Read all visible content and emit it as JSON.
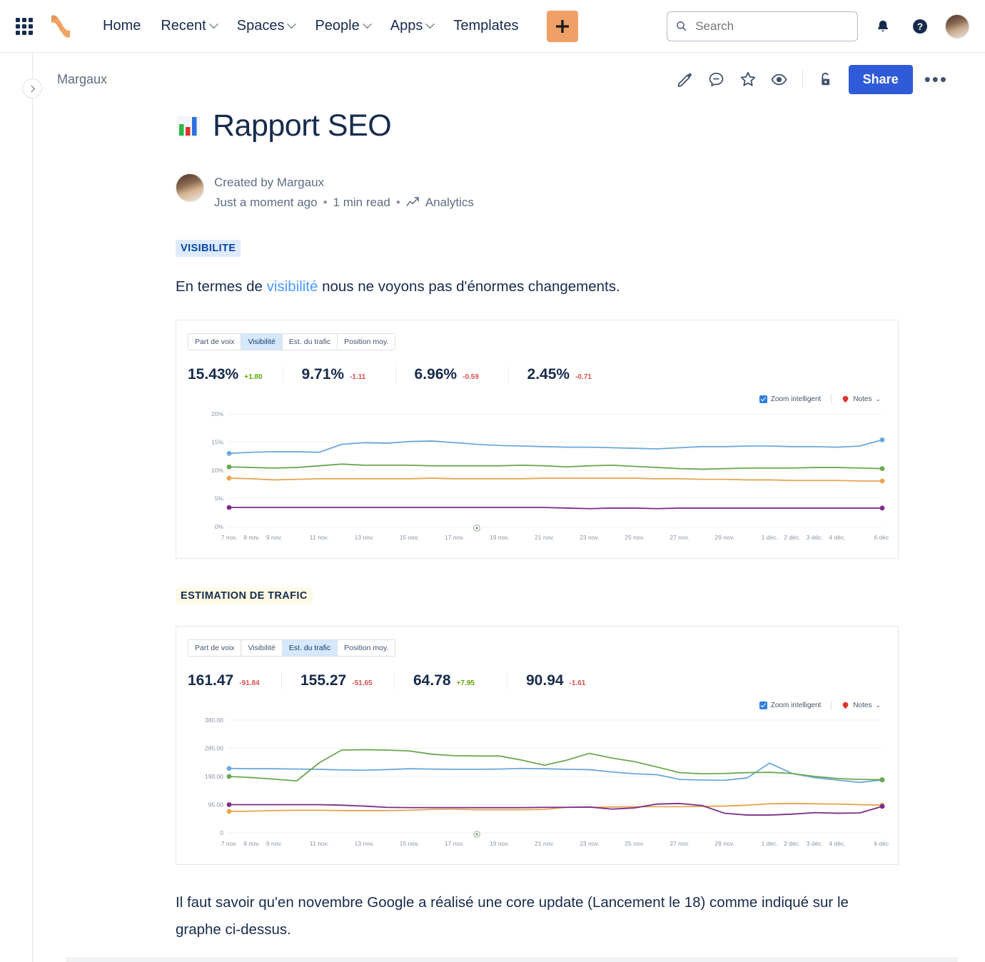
{
  "nav": {
    "app_switcher": "app-switcher-icon",
    "logo": "confluence-logo",
    "items": [
      {
        "label": "Home",
        "has_menu": false
      },
      {
        "label": "Recent",
        "has_menu": true
      },
      {
        "label": "Spaces",
        "has_menu": true
      },
      {
        "label": "People",
        "has_menu": true
      },
      {
        "label": "Apps",
        "has_menu": true
      },
      {
        "label": "Templates",
        "has_menu": false
      }
    ],
    "create_label": "+",
    "search_placeholder": "Search",
    "search_value": "",
    "notifications_icon": "notifications-bell-icon",
    "help_icon": "help-icon",
    "avatar": "user-avatar"
  },
  "page": {
    "breadcrumb": "Margaux",
    "actions": [
      "edit-icon",
      "comment-icon",
      "star-icon",
      "watch-icon",
      "restrictions-icon"
    ],
    "share_label": "Share",
    "more_label": "•••"
  },
  "document": {
    "title": "Rapport SEO",
    "title_emoji": "bar-chart-emoji",
    "created_by": "Created by Margaux",
    "timestamp": "Just a moment ago",
    "read_time": "1 min read",
    "analytics_label": "Analytics",
    "separator": "•",
    "section1": {
      "badge": "VISIBILITE",
      "paragraph_before": "En termes de ",
      "paragraph_link": "visibilité",
      "paragraph_after": " nous ne voyons pas d'énormes changements."
    },
    "section2": {
      "badge": "ESTIMATION DE TRAFIC"
    },
    "closing_paragraph": "Il faut savoir qu'en novembre Google a réalisé une core update (Lancement le 18) comme indiqué sur le graphe ci-dessus."
  },
  "charts_ui": {
    "tabs": [
      "Part de voix",
      "Visibilité",
      "Est. du trafic",
      "Position moy."
    ],
    "zoom_label": "Zoom intelligent",
    "notes_label": "Notes",
    "notes_chevron": "chevron-down-icon"
  },
  "chart_data": [
    {
      "type": "line",
      "title": "Visibilité",
      "active_tab": "Visibilité",
      "xlabel": "",
      "ylabel": "",
      "ylim": [
        0,
        20
      ],
      "yticks": [
        "0%",
        "5%",
        "10%",
        "15%",
        "20%"
      ],
      "ytick_values": [
        0,
        5,
        10,
        15,
        20
      ],
      "grid": true,
      "legend": "hidden",
      "metrics": [
        {
          "value": "15.43%",
          "delta": "+1.80",
          "direction": "up"
        },
        {
          "value": "9.71%",
          "delta": "-1.11",
          "direction": "down"
        },
        {
          "value": "6.96%",
          "delta": "-0.59",
          "direction": "down"
        },
        {
          "value": "2.45%",
          "delta": "-0.71",
          "direction": "down"
        }
      ],
      "x": [
        "7 nov.",
        "8 nov.",
        "9 nov.",
        "10 nov.",
        "11 nov.",
        "12 nov.",
        "13 nov.",
        "14 nov.",
        "15 nov.",
        "16 nov.",
        "17 nov.",
        "18 nov.",
        "19 nov.",
        "20 nov.",
        "21 nov.",
        "22 nov.",
        "23 nov.",
        "24 nov.",
        "25 nov.",
        "26 nov.",
        "27 nov.",
        "28 nov.",
        "29 nov.",
        "30 nov.",
        "1 déc.",
        "2 déc.",
        "3 déc.",
        "4 déc.",
        "5 déc.",
        "6 déc."
      ],
      "xticks": [
        "7 nov.",
        "8 nov.",
        "9 nov.",
        "11 nov.",
        "13 nov.",
        "15 nov.",
        "17 nov.",
        "19 nov.",
        "21 nov.",
        "23 nov.",
        "25 nov.",
        "27 nov.",
        "29 nov.",
        "1 déc.",
        "2 déc.",
        "3 déc.",
        "4 déc.",
        "6 déc."
      ],
      "series": [
        {
          "name": "series-blue",
          "color": "#6aa9dd",
          "values": [
            13.0,
            13.2,
            13.3,
            13.3,
            13.2,
            14.6,
            14.9,
            14.8,
            15.1,
            15.2,
            14.9,
            14.6,
            14.4,
            14.3,
            14.2,
            14.1,
            14.1,
            14.0,
            13.9,
            13.8,
            14.0,
            14.2,
            14.2,
            14.3,
            14.3,
            14.2,
            14.2,
            14.1,
            14.3,
            15.4
          ]
        },
        {
          "name": "series-green",
          "color": "#6aa84f",
          "values": [
            10.6,
            10.5,
            10.4,
            10.5,
            10.8,
            11.1,
            10.9,
            10.9,
            10.9,
            10.8,
            10.8,
            10.8,
            10.8,
            10.9,
            10.8,
            10.6,
            10.8,
            10.9,
            10.7,
            10.5,
            10.3,
            10.2,
            10.3,
            10.4,
            10.4,
            10.4,
            10.5,
            10.5,
            10.4,
            10.3
          ]
        },
        {
          "name": "series-orange",
          "color": "#e8a452",
          "values": [
            8.6,
            8.5,
            8.3,
            8.4,
            8.5,
            8.5,
            8.5,
            8.5,
            8.5,
            8.6,
            8.5,
            8.5,
            8.5,
            8.5,
            8.6,
            8.6,
            8.6,
            8.6,
            8.6,
            8.5,
            8.5,
            8.4,
            8.4,
            8.3,
            8.3,
            8.2,
            8.2,
            8.2,
            8.1,
            8.1
          ]
        },
        {
          "name": "series-purple",
          "color": "#7b2d8b",
          "values": [
            3.4,
            3.4,
            3.4,
            3.4,
            3.4,
            3.4,
            3.4,
            3.4,
            3.4,
            3.4,
            3.4,
            3.4,
            3.4,
            3.4,
            3.4,
            3.3,
            3.2,
            3.3,
            3.3,
            3.2,
            3.3,
            3.3,
            3.3,
            3.3,
            3.3,
            3.3,
            3.3,
            3.3,
            3.3,
            3.3
          ]
        }
      ]
    },
    {
      "type": "line",
      "title": "Est. du trafic",
      "active_tab": "Est. du trafic",
      "xlabel": "",
      "ylabel": "",
      "ylim": [
        0,
        380
      ],
      "yticks": [
        "0",
        "95.00",
        "190.00",
        "285.00",
        "380.00"
      ],
      "ytick_values": [
        0,
        95,
        190,
        285,
        380
      ],
      "grid": true,
      "legend": "hidden",
      "metrics": [
        {
          "value": "161.47",
          "delta": "-91.84",
          "direction": "down"
        },
        {
          "value": "155.27",
          "delta": "-51.65",
          "direction": "down"
        },
        {
          "value": "64.78",
          "delta": "+7.95",
          "direction": "up"
        },
        {
          "value": "90.94",
          "delta": "-1.61",
          "direction": "down"
        }
      ],
      "x": [
        "7 nov.",
        "8 nov.",
        "9 nov.",
        "10 nov.",
        "11 nov.",
        "12 nov.",
        "13 nov.",
        "14 nov.",
        "15 nov.",
        "16 nov.",
        "17 nov.",
        "18 nov.",
        "19 nov.",
        "20 nov.",
        "21 nov.",
        "22 nov.",
        "23 nov.",
        "24 nov.",
        "25 nov.",
        "26 nov.",
        "27 nov.",
        "28 nov.",
        "29 nov.",
        "30 nov.",
        "1 déc.",
        "2 déc.",
        "3 déc.",
        "4 déc.",
        "5 déc.",
        "6 déc."
      ],
      "xticks": [
        "7 nov.",
        "8 nov.",
        "9 nov.",
        "11 nov.",
        "13 nov.",
        "15 nov.",
        "17 nov.",
        "19 nov.",
        "21 nov.",
        "23 nov.",
        "25 nov.",
        "27 nov.",
        "29 nov.",
        "1 déc.",
        "2 déc.",
        "3 déc.",
        "4 déc.",
        "6 déc."
      ],
      "series": [
        {
          "name": "series-blue",
          "color": "#6aa9dd",
          "values": [
            217,
            216,
            216,
            215,
            214,
            212,
            211,
            213,
            216,
            215,
            214,
            214,
            215,
            217,
            216,
            214,
            213,
            205,
            199,
            196,
            180,
            178,
            177,
            185,
            235,
            200,
            186,
            178,
            170,
            178
          ]
        },
        {
          "name": "series-green",
          "color": "#6aa84f",
          "values": [
            190,
            186,
            181,
            175,
            236,
            279,
            280,
            279,
            276,
            265,
            260,
            259,
            259,
            245,
            228,
            245,
            268,
            252,
            240,
            222,
            203,
            199,
            200,
            203,
            204,
            200,
            190,
            183,
            180,
            179
          ]
        },
        {
          "name": "series-orange",
          "color": "#e8a452",
          "values": [
            72,
            73,
            75,
            76,
            76,
            75,
            75,
            75,
            76,
            79,
            80,
            78,
            78,
            78,
            79,
            86,
            86,
            87,
            88,
            88,
            88,
            89,
            90,
            93,
            98,
            99,
            98,
            97,
            95,
            93
          ]
        },
        {
          "name": "series-purple",
          "color": "#7b2d8b",
          "values": [
            95,
            95,
            95,
            95,
            95,
            93,
            90,
            86,
            85,
            85,
            85,
            85,
            85,
            85,
            86,
            86,
            87,
            80,
            84,
            97,
            99,
            92,
            66,
            60,
            60,
            63,
            68,
            66,
            67,
            89
          ]
        }
      ]
    }
  ]
}
